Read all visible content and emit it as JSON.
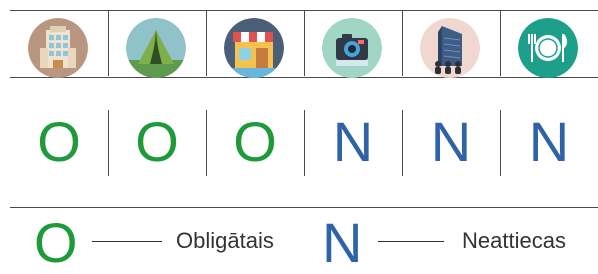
{
  "colors": {
    "obligatory": "#1f9a3a",
    "optional": "#2f63a8",
    "line": "#4a4a4a"
  },
  "columns": [
    {
      "icon": "hotel-building-icon",
      "code": "O",
      "type": "obligatory"
    },
    {
      "icon": "tent-icon",
      "code": "O",
      "type": "obligatory"
    },
    {
      "icon": "storefront-icon",
      "code": "O",
      "type": "obligatory"
    },
    {
      "icon": "camera-icon",
      "code": "N",
      "type": "optional"
    },
    {
      "icon": "office-building-people-icon",
      "code": "N",
      "type": "optional"
    },
    {
      "icon": "restaurant-plate-icon",
      "code": "N",
      "type": "optional"
    }
  ],
  "legend": {
    "obligatory_symbol": "O",
    "obligatory_label": "Obligātais",
    "optional_symbol": "N",
    "optional_label": "Neattiecas"
  }
}
